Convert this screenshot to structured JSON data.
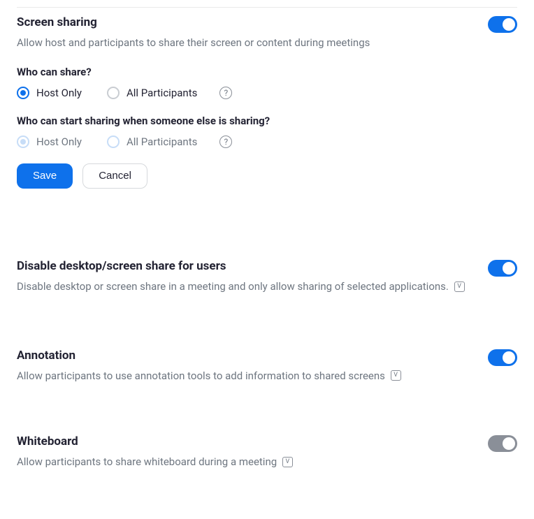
{
  "settings": {
    "screen_sharing": {
      "title": "Screen sharing",
      "desc": "Allow host and participants to share their screen or content during meetings",
      "enabled": true,
      "who_can_share": {
        "question": "Who can share?",
        "options": {
          "host_only": "Host Only",
          "all": "All Participants"
        },
        "selected": "host_only"
      },
      "who_can_start_when_someone_sharing": {
        "question": "Who can start sharing when someone else is sharing?",
        "options": {
          "host_only": "Host Only",
          "all": "All Participants"
        },
        "selected": "host_only",
        "disabled": true
      },
      "buttons": {
        "save": "Save",
        "cancel": "Cancel"
      }
    },
    "disable_desktop_share": {
      "title": "Disable desktop/screen share for users",
      "desc": "Disable desktop or screen share in a meeting and only allow sharing of selected applications.",
      "enabled": true,
      "badge": "V"
    },
    "annotation": {
      "title": "Annotation",
      "desc": "Allow participants to use annotation tools to add information to shared screens",
      "enabled": true,
      "badge": "V"
    },
    "whiteboard": {
      "title": "Whiteboard",
      "desc": "Allow participants to share whiteboard during a meeting",
      "enabled": false,
      "badge": "V"
    }
  },
  "help_icon_char": "?"
}
